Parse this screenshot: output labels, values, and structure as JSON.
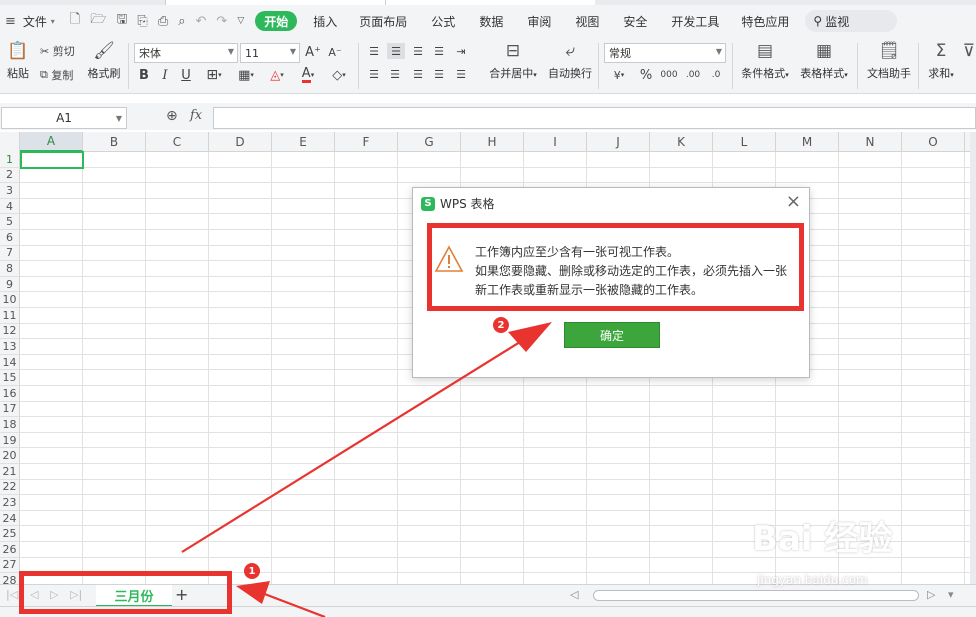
{
  "menubar": {
    "file": "文件",
    "tabs": [
      "开始",
      "插入",
      "页面布局",
      "公式",
      "数据",
      "审阅",
      "视图",
      "安全",
      "开发工具",
      "特色应用"
    ],
    "active_tab": "开始",
    "search": "监视"
  },
  "ribbon": {
    "paste": "粘贴",
    "cut": "剪切",
    "copy": "复制",
    "format_painter": "格式刷",
    "font_name": "宋体",
    "font_size": "11",
    "merge_center": "合并居中",
    "auto_wrap": "自动换行",
    "number_format": "常规",
    "conditional_format": "条件格式",
    "table_style": "表格样式",
    "doc_assistant": "文档助手",
    "sum": "求和",
    "bold": "B",
    "italic": "I",
    "underline": "U",
    "increase_font": "A⁺",
    "decrease_font": "A⁻"
  },
  "formula_bar": {
    "name_box": "A1",
    "fx": "fx"
  },
  "columns": [
    "A",
    "B",
    "C",
    "D",
    "E",
    "F",
    "G",
    "H",
    "I",
    "J",
    "K",
    "L",
    "M",
    "N",
    "O"
  ],
  "rows": [
    "1",
    "2",
    "3",
    "4",
    "5",
    "6",
    "7",
    "8",
    "9",
    "10",
    "11",
    "12",
    "13",
    "14",
    "15",
    "16",
    "17",
    "18",
    "19",
    "20",
    "21",
    "22",
    "23",
    "24",
    "25",
    "26",
    "27",
    "28"
  ],
  "sheet_tabs": {
    "active": "三月份",
    "add": "+"
  },
  "dialog": {
    "title": "WPS 表格",
    "line1": "工作簿内应至少含有一张可视工作表。",
    "line2": "如果您要隐藏、删除或移动选定的工作表，必须先插入一张",
    "line3": "新工作表或重新显示一张被隐藏的工作表。",
    "ok": "确定"
  },
  "annotations": {
    "badge1": "1",
    "badge2": "2"
  },
  "watermark": {
    "logo": "Bai 经验",
    "url": "jingyan.baidu.com"
  },
  "colors": {
    "accent": "#2eb85c",
    "annotation_red": "#e8332f"
  }
}
